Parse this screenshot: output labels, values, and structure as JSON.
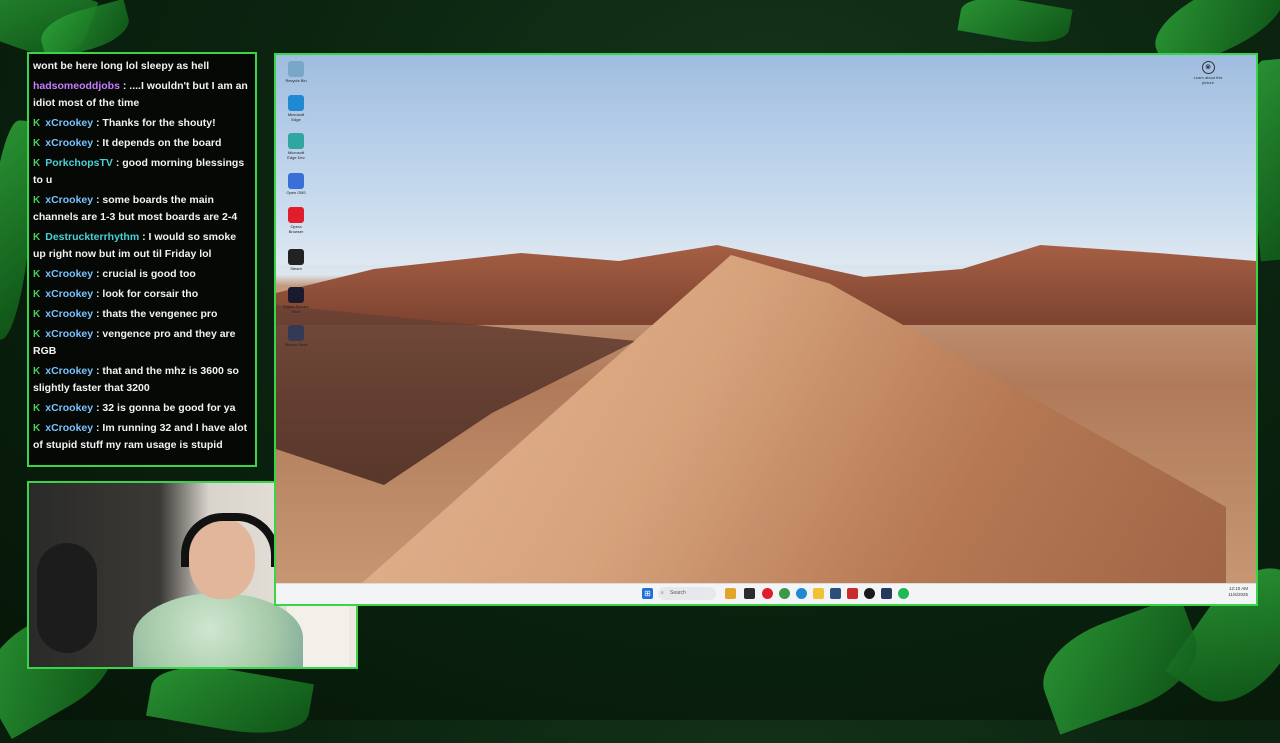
{
  "chat": {
    "messages": [
      {
        "user": "",
        "user_color": "#ffffff",
        "badge": "",
        "text": "wont be here long lol sleepy as hell"
      },
      {
        "user": "hadsomeoddjobs",
        "user_color": "#c77dff",
        "badge": "",
        "text": ": ....I wouldn't but I am an idiot most of the time"
      },
      {
        "user": "xCrookey",
        "user_color": "#79c2ff",
        "badge": "K",
        "text": ": Thanks for the shouty!"
      },
      {
        "user": "xCrookey",
        "user_color": "#79c2ff",
        "badge": "K",
        "text": ": It depends on the board"
      },
      {
        "user": "PorkchopsTV",
        "user_color": "#4ad0d8",
        "badge": "K",
        "text": ": good morning blessings to u"
      },
      {
        "user": "xCrookey",
        "user_color": "#79c2ff",
        "badge": "K",
        "text": ": some boards the main channels are 1-3 but most boards are 2-4"
      },
      {
        "user": "Destruckterrhythm",
        "user_color": "#4ad0d8",
        "badge": "K",
        "text": ": I would so smoke up right now but im out til Friday lol"
      },
      {
        "user": "xCrookey",
        "user_color": "#79c2ff",
        "badge": "K",
        "text": ": crucial is good too"
      },
      {
        "user": "xCrookey",
        "user_color": "#79c2ff",
        "badge": "K",
        "text": ": look for corsair tho"
      },
      {
        "user": "xCrookey",
        "user_color": "#79c2ff",
        "badge": "K",
        "text": ": thats the vengenec pro"
      },
      {
        "user": "xCrookey",
        "user_color": "#79c2ff",
        "badge": "K",
        "text": ": vengence pro and they are RGB"
      },
      {
        "user": "xCrookey",
        "user_color": "#79c2ff",
        "badge": "K",
        "text": ": that and the mhz is 3600 so slightly faster that 3200"
      },
      {
        "user": "xCrookey",
        "user_color": "#79c2ff",
        "badge": "K",
        "text": ": 32 is gonna be good for ya"
      },
      {
        "user": "xCrookey",
        "user_color": "#79c2ff",
        "badge": "K",
        "text": ": Im running 32 and I have alot of stupid stuff my ram usage is stupid"
      }
    ]
  },
  "desktop": {
    "icons": [
      {
        "name": "recycle-bin-icon",
        "label": "Recycle Bin",
        "color": "#7aa6c8"
      },
      {
        "name": "edge-icon",
        "label": "Microsoft Edge",
        "color": "#1f8ad2"
      },
      {
        "name": "edge-dev-icon",
        "label": "Microsoft Edge Dev",
        "color": "#2fa7a0"
      },
      {
        "name": "obs-icon",
        "label": "Open OBS",
        "color": "#3a6fd8"
      },
      {
        "name": "opera-icon",
        "label": "Opera Browser",
        "color": "#e01d2a"
      },
      {
        "name": "steam-icon",
        "label": "Steam",
        "color": "#222222"
      },
      {
        "name": "app-icon",
        "label": "Elgato Stream Deck",
        "color": "#1a1a2e"
      },
      {
        "name": "stream-deck-icon",
        "label": "Stream Deck",
        "color": "#333a55"
      }
    ],
    "widget_label": "Learn about this picture"
  },
  "taskbar": {
    "search_placeholder": "Search",
    "time": "12:10 AM",
    "date": "11/6/2025"
  },
  "colors": {
    "border": "#3bd34a",
    "chat_bg": "#050805"
  }
}
